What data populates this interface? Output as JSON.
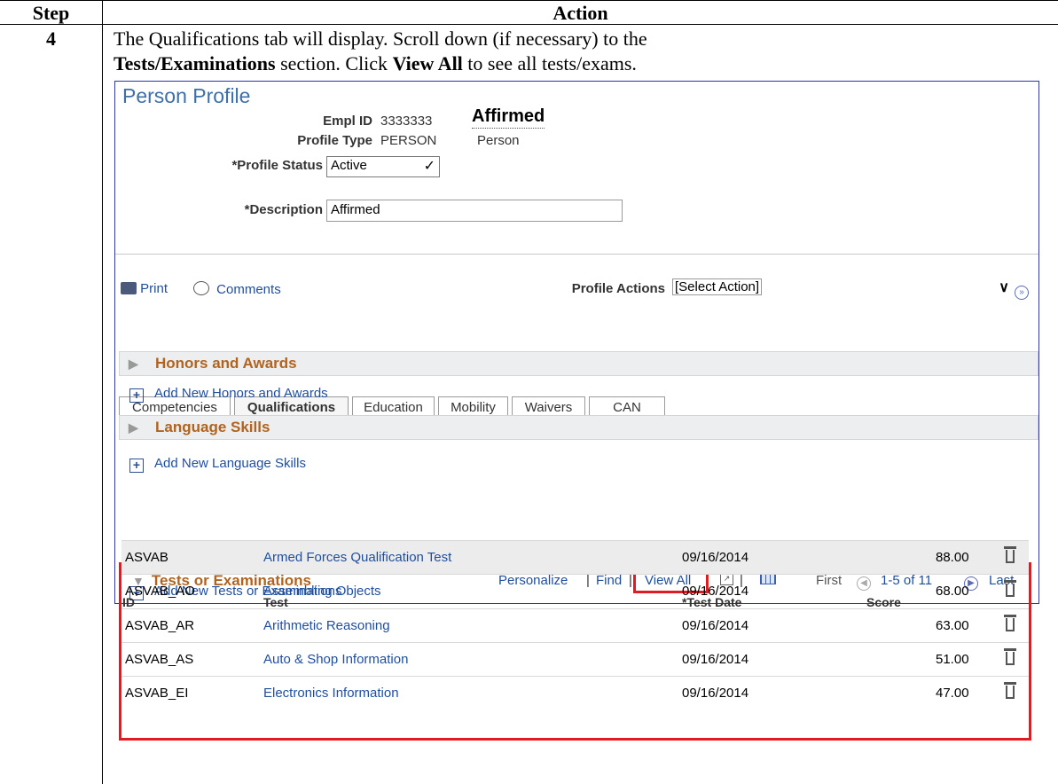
{
  "doc": {
    "header_step": "Step",
    "header_action": "Action",
    "step_number": "4",
    "instruction": {
      "line1": "The Qualifications tab will display. Scroll down (if necessary) to the",
      "bold1": "Tests/Examinations",
      "mid1": " section. Click ",
      "bold2": "View All",
      "end1": " to see all tests/exams."
    }
  },
  "profile": {
    "title": "Person Profile",
    "empl_id_label": "Empl ID",
    "empl_id_value": "3333333",
    "name_value": "Affirmed",
    "profile_type_label": "Profile Type",
    "profile_type_value": "PERSON",
    "profile_type_desc": "Person",
    "profile_status_label": "*Profile Status",
    "profile_status_value": "Active",
    "description_label": "*Description",
    "description_value": "Affirmed"
  },
  "toolbar": {
    "print_label": "Print",
    "comments_label": "Comments",
    "profile_actions_label": "Profile Actions",
    "profile_actions_value": "[Select Action]"
  },
  "tabs": [
    {
      "label": "Competencies",
      "active": false
    },
    {
      "label": "Qualifications",
      "active": true
    },
    {
      "label": "Education",
      "active": false
    },
    {
      "label": "Mobility",
      "active": false
    },
    {
      "label": "Waivers",
      "active": false
    },
    {
      "label": "CAN",
      "active": false
    }
  ],
  "sections": {
    "honors_title": "Honors and Awards",
    "honors_add": "Add New Honors and Awards",
    "language_title": "Language Skills",
    "language_add": "Add New Language Skills"
  },
  "tests_grid": {
    "title": "Tests or Examinations",
    "personalize": "Personalize",
    "sep": "|",
    "find": "Find",
    "view_all": "View All",
    "first": "First",
    "range": "1-5 of 11",
    "last": "Last",
    "columns": [
      "ID",
      "Test",
      "*Test Date",
      "Score"
    ],
    "rows": [
      {
        "id": "ASVAB",
        "test": "Armed Forces Qualification Test",
        "date": "09/16/2014",
        "score": "88.00"
      },
      {
        "id": "ASVAB_AO",
        "test": "Assembling Objects",
        "date": "09/16/2014",
        "score": "68.00"
      },
      {
        "id": "ASVAB_AR",
        "test": "Arithmetic Reasoning",
        "date": "09/16/2014",
        "score": "63.00"
      },
      {
        "id": "ASVAB_AS",
        "test": "Auto & Shop Information",
        "date": "09/16/2014",
        "score": "51.00"
      },
      {
        "id": "ASVAB_EI",
        "test": "Electronics Information",
        "date": "09/16/2014",
        "score": "47.00"
      }
    ],
    "add_new": "Add New Tests or Examinations"
  },
  "colors": {
    "highlight": "#e11b22",
    "link": "#1f4e9b",
    "section_title": "#b0641f"
  }
}
